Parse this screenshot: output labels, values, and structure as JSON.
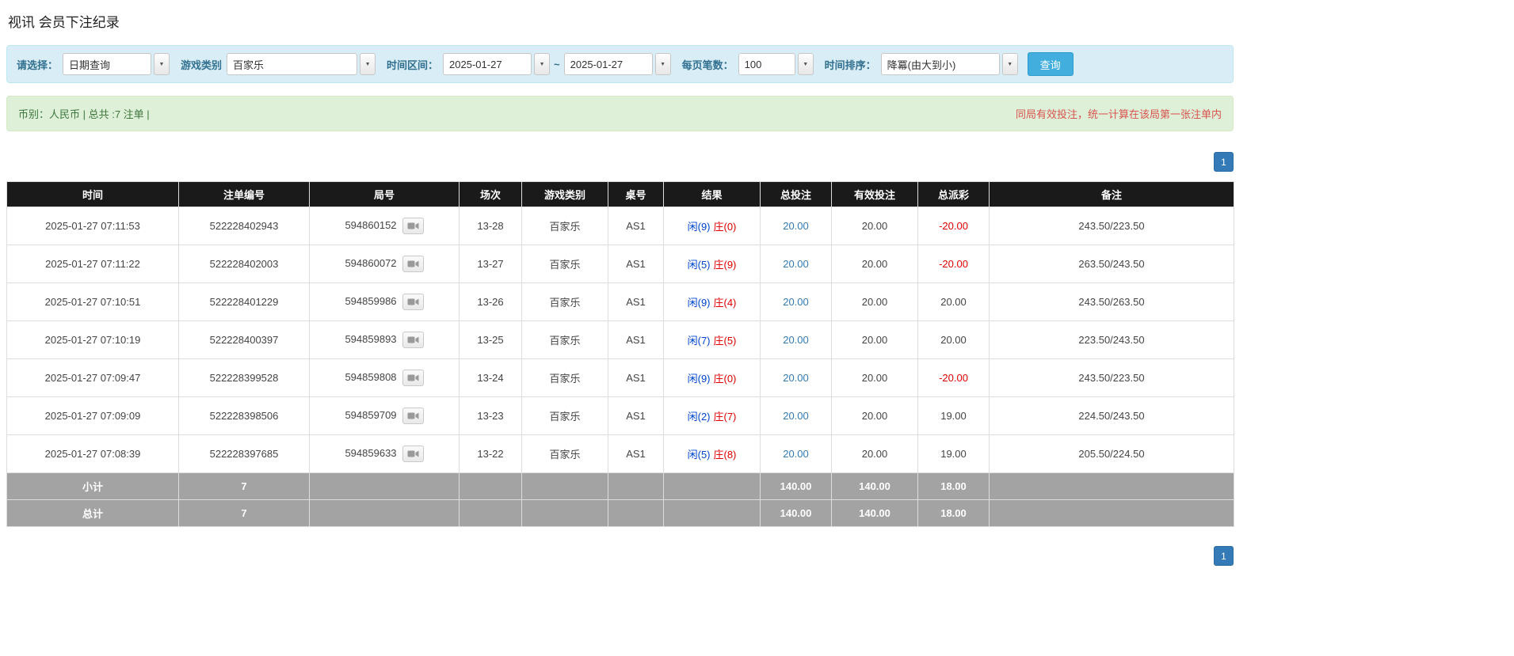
{
  "page": {
    "title": "视讯 会员下注纪录"
  },
  "filters": {
    "select_label": "请选择：",
    "select_value": "日期查询",
    "game_type_label": "游戏类别",
    "game_type_value": "百家乐",
    "time_range_label": "时间区间：",
    "date_from": "2025-01-27",
    "date_to": "2025-01-27",
    "range_separator": "~",
    "page_size_label": "每页笔数：",
    "page_size_value": "100",
    "sort_label": "时间排序：",
    "sort_value": "降冪(由大到小)",
    "search_button": "查询"
  },
  "info_bar": {
    "summary": "币别：人民币 | 总共 :7 注单 |",
    "notice": "同局有效投注，统一计算在该局第一张注单内"
  },
  "pagination": {
    "page": "1"
  },
  "icons": {
    "dropdown_arrow": "▼",
    "video_replay": "video-camera"
  },
  "colors": {
    "header_bg": "#1a1a1a",
    "summary_row_bg": "#a3a3a3",
    "filter_bar_bg": "#d9edf7",
    "info_bar_bg": "#dff0d8",
    "accent_blue": "#337ab7",
    "player_blue": "#0044cc",
    "banker_red": "#e00000",
    "negative_red": "#e00000"
  },
  "table": {
    "headers": [
      "时间",
      "注单编号",
      "局号",
      "场次",
      "游戏类别",
      "桌号",
      "结果",
      "总投注",
      "有效投注",
      "总派彩",
      "备注"
    ],
    "rows": [
      {
        "time": "2025-01-27 07:11:53",
        "bet_id": "522228402943",
        "round_id": "594860152",
        "session": "13-28",
        "game": "百家乐",
        "table_no": "AS1",
        "result_player": "闲(9)",
        "result_banker": "庄(0)",
        "total_bet": "20.00",
        "valid_bet": "20.00",
        "payout": "-20.00",
        "remark": "243.50/223.50"
      },
      {
        "time": "2025-01-27 07:11:22",
        "bet_id": "522228402003",
        "round_id": "594860072",
        "session": "13-27",
        "game": "百家乐",
        "table_no": "AS1",
        "result_player": "闲(5)",
        "result_banker": "庄(9)",
        "total_bet": "20.00",
        "valid_bet": "20.00",
        "payout": "-20.00",
        "remark": "263.50/243.50"
      },
      {
        "time": "2025-01-27 07:10:51",
        "bet_id": "522228401229",
        "round_id": "594859986",
        "session": "13-26",
        "game": "百家乐",
        "table_no": "AS1",
        "result_player": "闲(9)",
        "result_banker": "庄(4)",
        "total_bet": "20.00",
        "valid_bet": "20.00",
        "payout": "20.00",
        "remark": "243.50/263.50"
      },
      {
        "time": "2025-01-27 07:10:19",
        "bet_id": "522228400397",
        "round_id": "594859893",
        "session": "13-25",
        "game": "百家乐",
        "table_no": "AS1",
        "result_player": "闲(7)",
        "result_banker": "庄(5)",
        "total_bet": "20.00",
        "valid_bet": "20.00",
        "payout": "20.00",
        "remark": "223.50/243.50"
      },
      {
        "time": "2025-01-27 07:09:47",
        "bet_id": "522228399528",
        "round_id": "594859808",
        "session": "13-24",
        "game": "百家乐",
        "table_no": "AS1",
        "result_player": "闲(9)",
        "result_banker": "庄(0)",
        "total_bet": "20.00",
        "valid_bet": "20.00",
        "payout": "-20.00",
        "remark": "243.50/223.50"
      },
      {
        "time": "2025-01-27 07:09:09",
        "bet_id": "522228398506",
        "round_id": "594859709",
        "session": "13-23",
        "game": "百家乐",
        "table_no": "AS1",
        "result_player": "闲(2)",
        "result_banker": "庄(7)",
        "total_bet": "20.00",
        "valid_bet": "20.00",
        "payout": "19.00",
        "remark": "224.50/243.50"
      },
      {
        "time": "2025-01-27 07:08:39",
        "bet_id": "522228397685",
        "round_id": "594859633",
        "session": "13-22",
        "game": "百家乐",
        "table_no": "AS1",
        "result_player": "闲(5)",
        "result_banker": "庄(8)",
        "total_bet": "20.00",
        "valid_bet": "20.00",
        "payout": "19.00",
        "remark": "205.50/224.50"
      }
    ],
    "footer_rows": [
      {
        "label": "小计",
        "count": "7",
        "total_bet": "140.00",
        "valid_bet": "140.00",
        "payout": "18.00"
      },
      {
        "label": "总计",
        "count": "7",
        "total_bet": "140.00",
        "valid_bet": "140.00",
        "payout": "18.00"
      }
    ]
  }
}
